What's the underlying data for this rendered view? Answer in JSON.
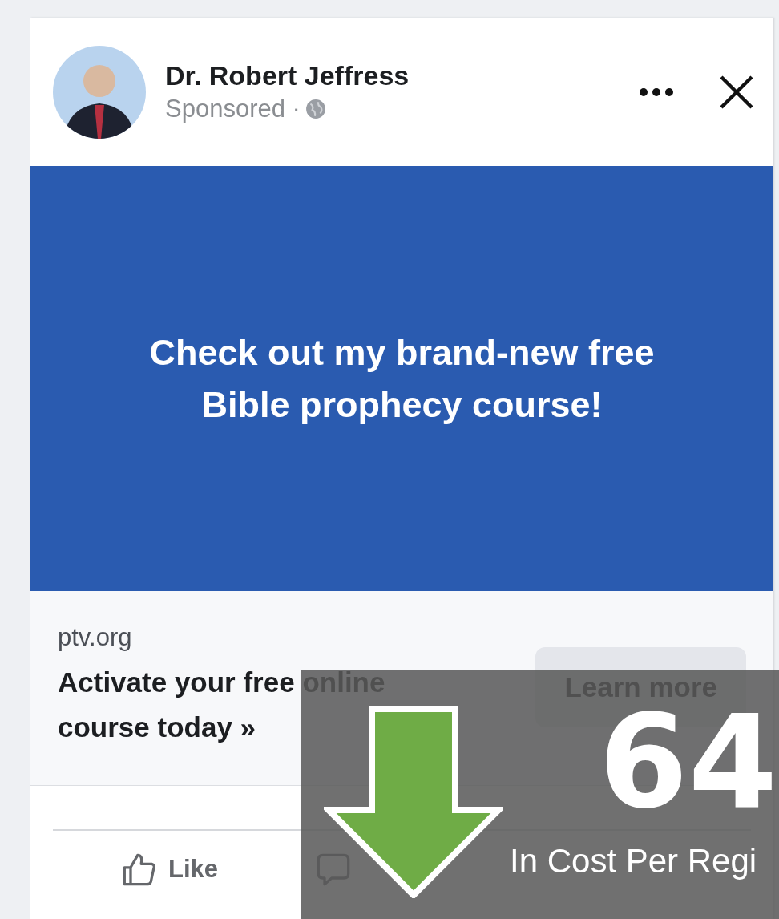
{
  "post": {
    "author": "Dr. Robert Jeffress",
    "meta": "Sponsored ·",
    "banner_text": "Check out my brand-new free Bible prophecy course!",
    "link": {
      "domain": "ptv.org",
      "headline": "Activate your free online course today »",
      "button": "Learn more"
    },
    "actions": [
      {
        "label": "Like",
        "kind": "like"
      },
      {
        "kind": "comment"
      }
    ]
  },
  "overlay": {
    "figure": "64",
    "caption": "In Cost Per Regi"
  }
}
